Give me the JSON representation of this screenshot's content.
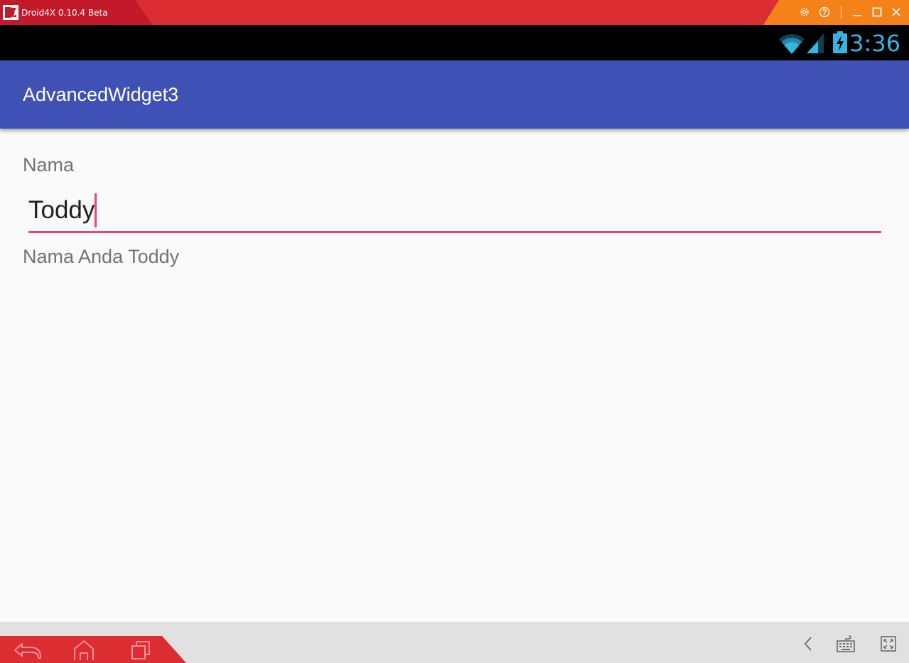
{
  "window": {
    "title": "Droid4X 0.10.4 Beta",
    "accent_left": "#c4192a",
    "accent_main": "#dc2d33",
    "accent_right": "#f58219"
  },
  "window_controls": [
    "settings-icon",
    "help-icon",
    "minimize-icon",
    "maximize-icon",
    "close-icon"
  ],
  "status_bar": {
    "time": "3:36",
    "time_color": "#33b5e5",
    "icons": [
      "wifi-icon",
      "signal-icon",
      "battery-charging-icon"
    ]
  },
  "app_bar": {
    "title": "AdvancedWidget3",
    "color": "#3f51b5"
  },
  "form": {
    "label": "Nama",
    "input_value": "Toddy",
    "accent_color": "#ef4180",
    "result_text": "Nama Anda Toddy"
  },
  "bottom_bar": {
    "left_buttons": [
      "back-icon",
      "home-icon",
      "recent-apps-icon"
    ],
    "right_buttons": [
      "chevron-left-icon",
      "keyboard-icon",
      "fullscreen-icon"
    ]
  }
}
